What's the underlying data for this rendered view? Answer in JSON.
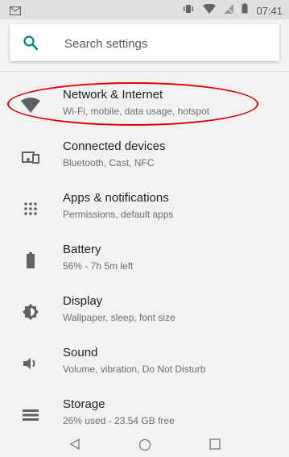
{
  "status_bar": {
    "time": "07:41",
    "icons": [
      "mail-icon",
      "vibrate-icon",
      "wifi-icon",
      "no-signal-icon",
      "battery-icon"
    ]
  },
  "search": {
    "placeholder": "Search settings",
    "icon": "search-icon",
    "accent_color": "#00897b"
  },
  "settings": [
    {
      "title": "Network & Internet",
      "subtitle": "Wi-Fi, mobile, data usage, hotspot",
      "icon": "wifi-icon"
    },
    {
      "title": "Connected devices",
      "subtitle": "Bluetooth, Cast, NFC",
      "icon": "devices-icon"
    },
    {
      "title": "Apps & notifications",
      "subtitle": "Permissions, default apps",
      "icon": "apps-grid-icon"
    },
    {
      "title": "Battery",
      "subtitle": "56% - 7h 5m left",
      "icon": "battery-icon"
    },
    {
      "title": "Display",
      "subtitle": "Wallpaper, sleep, font size",
      "icon": "brightness-icon"
    },
    {
      "title": "Sound",
      "subtitle": "Volume, vibration, Do Not Disturb",
      "icon": "volume-icon"
    },
    {
      "title": "Storage",
      "subtitle": "26% used - 23.54 GB free",
      "icon": "storage-icon"
    }
  ],
  "annotation": {
    "color": "#e00000",
    "target": "Network & Internet"
  },
  "nav_bar": {
    "buttons": [
      "back-icon",
      "home-icon",
      "recents-icon"
    ]
  }
}
